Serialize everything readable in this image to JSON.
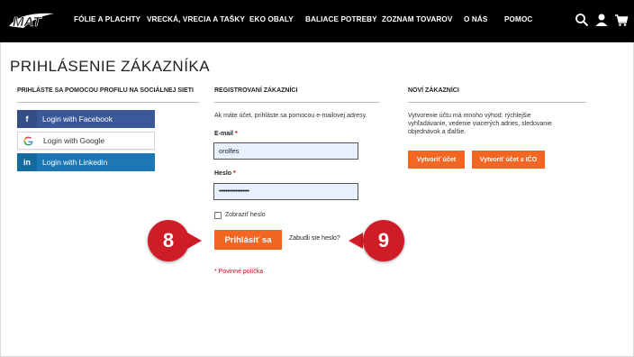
{
  "header": {
    "logo_text": "MAT",
    "nav": [
      "FÓLIE A PLACHTY",
      "VRECKÁ, VRECIA A TAŠKY",
      "EKO OBALY",
      "BALIACE POTREBY",
      "ZOZNAM TOVAROV",
      "O NÁS",
      "POMOC"
    ],
    "icons": [
      "search-icon",
      "user-icon",
      "cart-icon"
    ]
  },
  "page": {
    "title": "PRIHLÁSENIE ZÁKAZNÍKA"
  },
  "social": {
    "heading": "PRIHLÁSTE SA POMOCOU PROFILU NA SOCIÁLNEJ SIETI",
    "facebook_label": "Login with Facebook",
    "google_label": "Login with Google",
    "linkedin_label": "Login with Linkedin",
    "colors": {
      "facebook": "#3b5998",
      "linkedin": "#1b78b4"
    }
  },
  "registered": {
    "heading": "REGISTROVANÍ ZÁKAZNÍCI",
    "intro": "Ak máte účet, prihláste sa pomocou e-mailovej adresy.",
    "email_label": "E-mail",
    "email_value": "orolfes",
    "password_label": "Heslo",
    "password_value": "••••••••••••••••••",
    "required_mark": "*",
    "show_password_label": "Zobraziť heslo",
    "login_button": "Prihlásiť sa",
    "forgot_link": "Zabudli ste heslo?",
    "required_note": "* Povinné políčka"
  },
  "new_customers": {
    "heading": "NOVÍ ZÁKAZNÍCI",
    "description_lines": [
      "Vytvorenie účtu má mnoho výhod: rýchlejšie",
      "vyhľadávanie, vedenie viacerých adries, sledovanie",
      "objednávok a ďalšie."
    ],
    "create_account_button": "Vytvoriť účet",
    "create_account_ico_button": "Vytvoriť účet s IČO"
  },
  "annotations": {
    "badge_left": "8",
    "badge_right": "9",
    "color": "#cf1d27"
  },
  "accent_color": "#f26522"
}
